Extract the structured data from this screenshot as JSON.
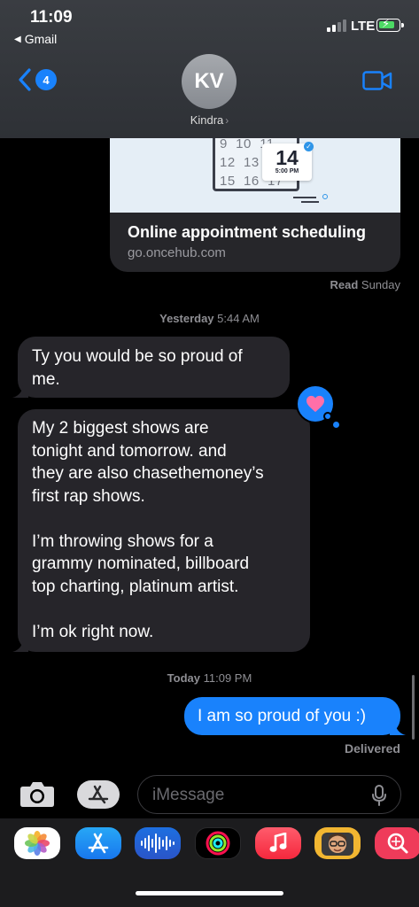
{
  "status_bar": {
    "time": "11:09",
    "return_app": "Gmail",
    "network": "LTE",
    "signal_bars_filled": 2,
    "signal_bars_total": 4,
    "battery_charging": true
  },
  "header": {
    "back_badge_count": "4",
    "avatar_initials": "KV",
    "contact_name": "Kindra",
    "chevron": "›",
    "video_icon": "video-camera-icon"
  },
  "link_preview": {
    "calendar_numbers": "9  10  11\n12  13\n15  16  17",
    "calendar_day": "14",
    "calendar_time": "5:00 PM",
    "title": "Online appointment scheduling",
    "url": "go.oncehub.com"
  },
  "read_receipt": {
    "label": "Read",
    "when": "Sunday"
  },
  "timestamps": [
    {
      "day": "Yesterday",
      "time": "5:44 AM"
    },
    {
      "day": "Today",
      "time": "11:09 PM"
    }
  ],
  "messages": [
    {
      "from": "them",
      "text": "Ty you would be so proud of\nme."
    },
    {
      "from": "them",
      "text": "My 2 biggest shows are\ntonight and tomorrow. and\nthey are also chasethemoney’s\nfirst rap shows.\n\nI’m throwing shows for a\ngrammy nominated, billboard\ntop charting, platinum artist.\n\nI’m ok right now.",
      "tapback": "heart"
    },
    {
      "from": "me",
      "text": "I am so proud of you :)"
    }
  ],
  "delivery_status": "Delivered",
  "composer": {
    "placeholder": "iMessage"
  },
  "app_drawer": [
    "photos-icon",
    "app-store-icon",
    "audio-message-icon",
    "activity-icon",
    "music-icon",
    "memoji-icon",
    "search-images-icon"
  ],
  "colors": {
    "imessage_blue": "#1982fc",
    "incoming_bubble": "#26252a",
    "header_bg": "#34373c",
    "secondary_text": "#8e8e93"
  }
}
